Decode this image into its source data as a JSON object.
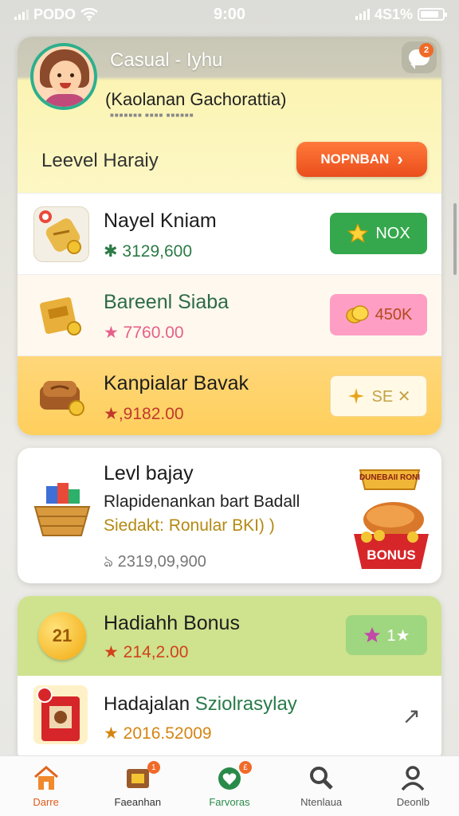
{
  "status_bar": {
    "carrier": "PODO",
    "time": "9:00",
    "battery_text": "4S1%"
  },
  "header": {
    "title": "Casual - Iyhu",
    "subtitle": "(Kaolanan Gachorattia)",
    "notification_count": "2",
    "level_label": "Leevel Haraiy",
    "promo_button_label": "NOPNBAN"
  },
  "rewards": [
    {
      "name": "Nayel Kniam",
      "price": "✱ 3129,600",
      "action": "NOX",
      "action_icon": "star-icon"
    },
    {
      "name": "Bareenl Siaba",
      "price": "★ 7760.00",
      "action": "450K",
      "action_icon": "coin-icon"
    },
    {
      "name": "Kanpialar Bavak",
      "price": "★,9182.00",
      "action": "SE ✕",
      "action_icon": "sparkle-icon"
    }
  ],
  "level_card": {
    "title": "Levl bajay",
    "description": "Rlapidenankan bart Badall",
    "note": "Siedakt: Ronular BKI) )",
    "value": "ঌ 2319,09,900",
    "banner_label": "DUNEBAII RONI",
    "bonus_label": "BONUS"
  },
  "bonus_card": {
    "coin_label": "21",
    "title": "Hadiahh Bonus",
    "price": "★ 214,2.00",
    "action": "1★",
    "row_title_a": "Hadajalan ",
    "row_title_b": "Sziolrasylay",
    "row_price": "★ 2016.52009",
    "row_arrow": "↗"
  },
  "tabs": [
    {
      "label": "Darre",
      "icon": "home-icon"
    },
    {
      "label": "Faeanhan",
      "icon": "shop-icon",
      "badge": "1"
    },
    {
      "label": "Farvoras",
      "icon": "favorites-icon",
      "badge": "£"
    },
    {
      "label": "Ntenlaua",
      "icon": "search-icon"
    },
    {
      "label": "Deonlb",
      "icon": "profile-icon"
    }
  ],
  "colors": {
    "accent_orange": "#ea4d1c",
    "green": "#35a84d",
    "gold": "#ffcf5c",
    "pink": "#ff9ec4"
  }
}
